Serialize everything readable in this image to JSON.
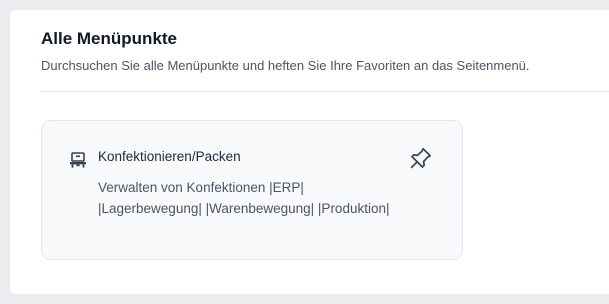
{
  "header": {
    "title": "Alle Menüpunkte",
    "subtitle": "Durchsuchen Sie alle Menüpunkte und heften Sie Ihre Favoriten an das Seitenmenü."
  },
  "cards": [
    {
      "icon": "packing-station-icon",
      "title": "Konfektionieren/Packen",
      "description": "Verwalten von Konfektionen |ERP| |Lagerbewegung| |Warenbewegung| |Produktion|",
      "pin_icon": "pin-icon"
    }
  ]
}
